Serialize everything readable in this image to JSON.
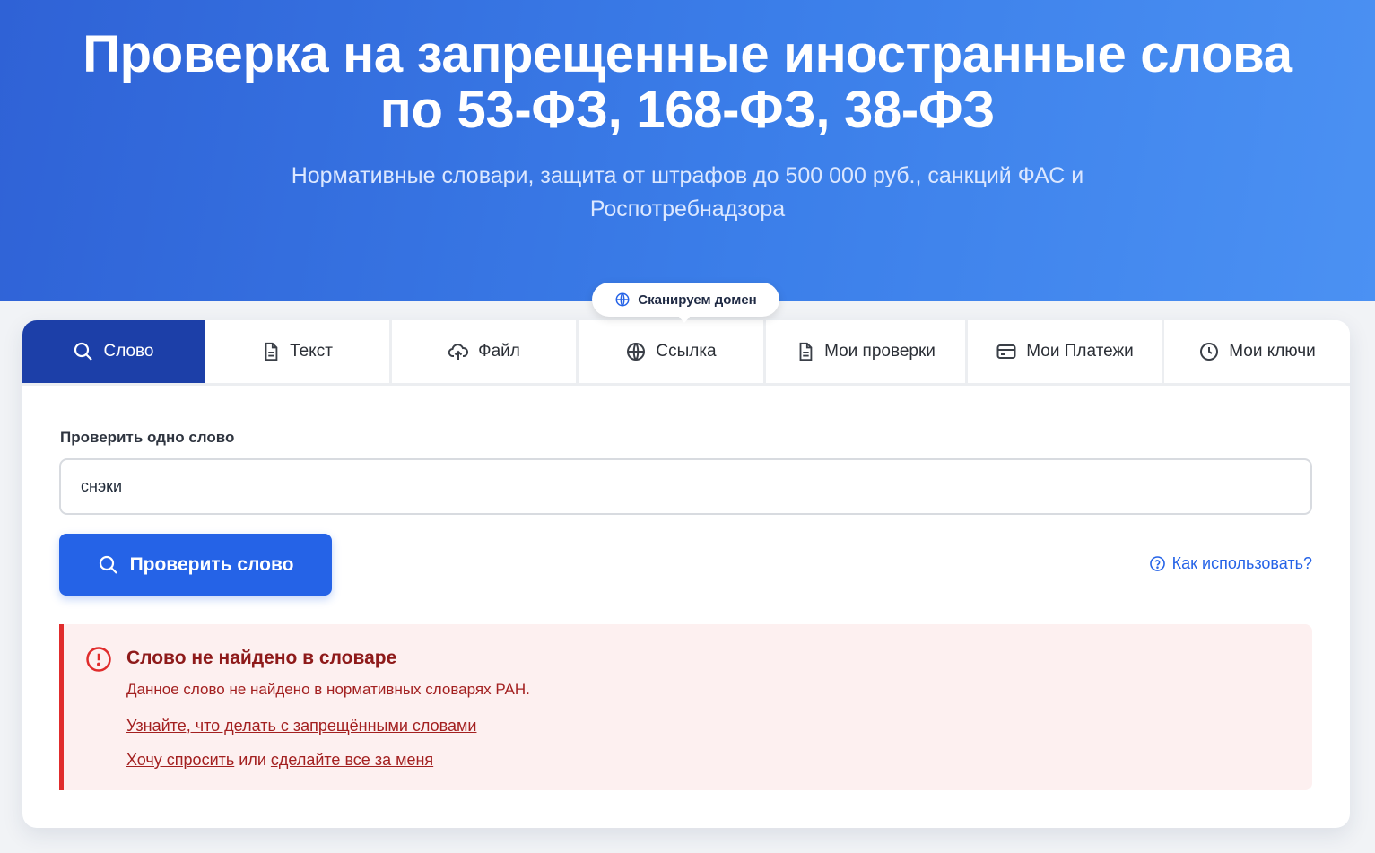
{
  "hero": {
    "title_line1": "Проверка на запрещенные иностранные слова",
    "title_line2": "по 53-ФЗ, 168-ФЗ, 38-ФЗ",
    "subtitle_line1": "Нормативные словари, защита от штрафов до 500 000 руб., санкций ФАС и",
    "subtitle_line2": "Роспотребнадзора"
  },
  "badge": {
    "label": "Сканируем домен",
    "icon": "globe-icon"
  },
  "tabs": [
    {
      "label": "Слово",
      "icon": "search-icon",
      "active": true
    },
    {
      "label": "Текст",
      "icon": "document-icon",
      "active": false
    },
    {
      "label": "Файл",
      "icon": "cloud-upload-icon",
      "active": false
    },
    {
      "label": "Ссылка",
      "icon": "globe-icon",
      "active": false
    },
    {
      "label": "Мои проверки",
      "icon": "document-icon",
      "active": false
    },
    {
      "label": "Мои Платежи",
      "icon": "credit-card-icon",
      "active": false
    },
    {
      "label": "Мои ключи",
      "icon": "clock-icon",
      "active": false
    }
  ],
  "form": {
    "label": "Проверить одно слово",
    "input_value": "снэки",
    "submit_label": "Проверить слово",
    "help_label": "Как использовать?"
  },
  "alert": {
    "title": "Слово не найдено в словаре",
    "text": "Данное слово не найдено в нормативных словарях РАН.",
    "link_learn": "Узнайте, что делать с запрещёнными словами",
    "link_ask": "Хочу спросить",
    "separator": "или",
    "link_do": "сделайте все за меня"
  },
  "colors": {
    "accent": "#2563e7",
    "active_tab": "#1c3fa8",
    "alert_border": "#e02c2c",
    "alert_bg": "#fdf0f0"
  }
}
